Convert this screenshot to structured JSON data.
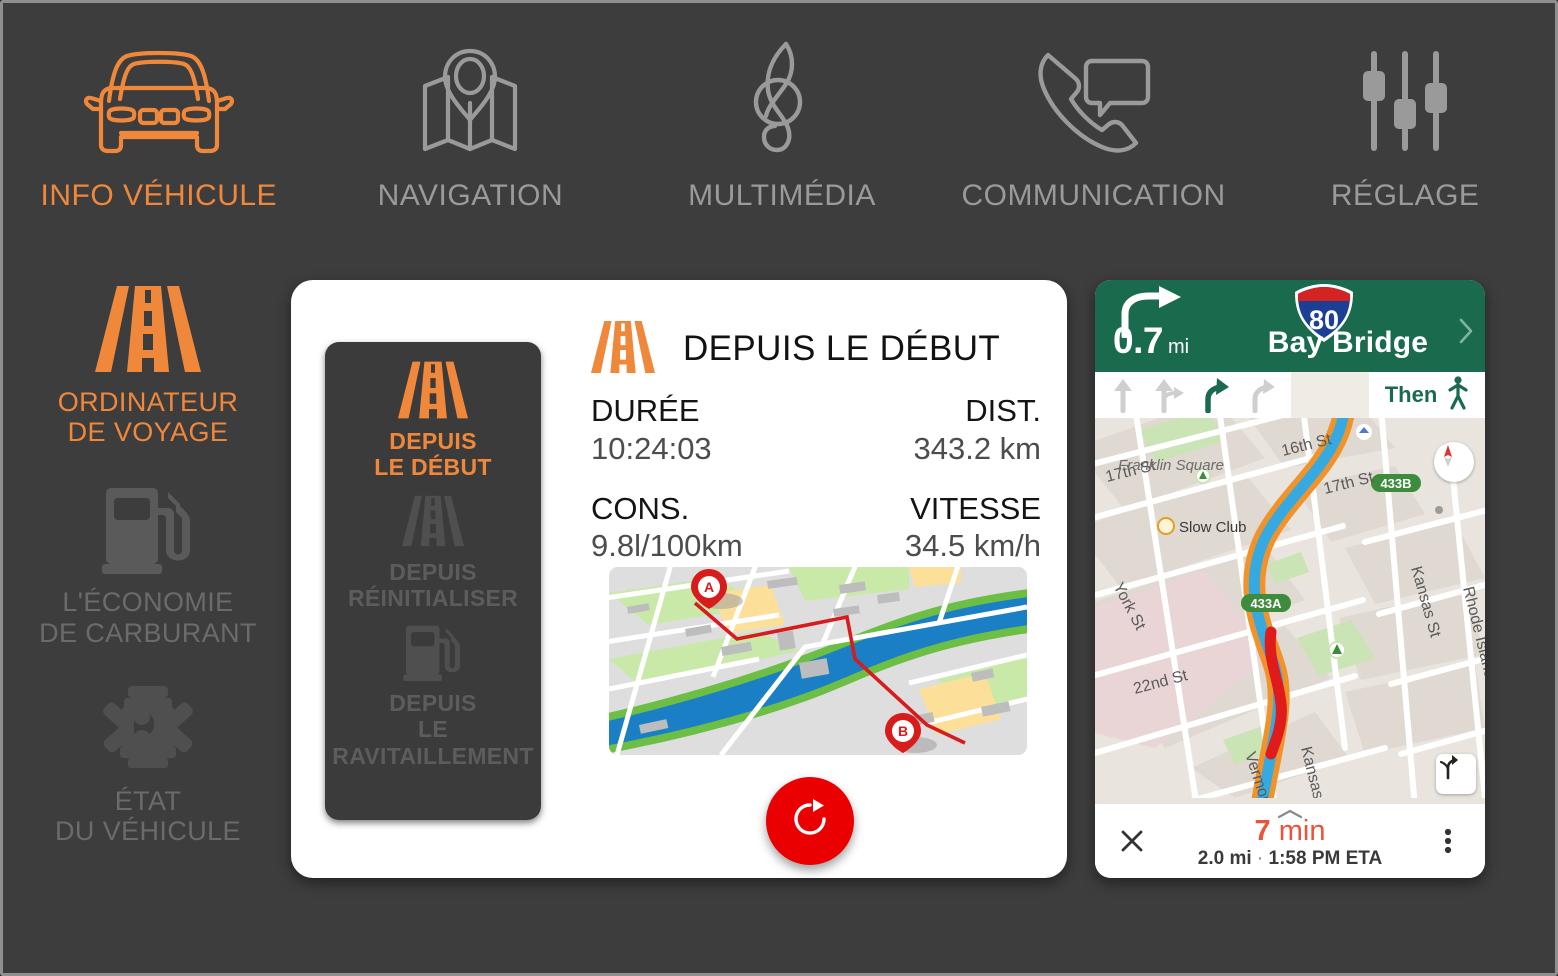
{
  "theme": {
    "background": "#3d3d3d",
    "accent_orange": "#f0883c",
    "inactive_gray": "#9a9a9a",
    "card_white": "#ffffff",
    "reset_red": "#ea0000",
    "nav_green": "#1a6b4e",
    "eta_red": "#e8553a"
  },
  "topnav": {
    "items": [
      {
        "label": "INFO VÉHICULE",
        "icon": "car-icon",
        "active": true
      },
      {
        "label": "NAVIGATION",
        "icon": "map-pin-icon",
        "active": false
      },
      {
        "label": "MULTIMÉDIA",
        "icon": "treble-clef-icon",
        "active": false
      },
      {
        "label": "COMMUNICATION",
        "icon": "phone-chat-icon",
        "active": false
      },
      {
        "label": "RÉGLAGE",
        "icon": "sliders-icon",
        "active": false
      }
    ]
  },
  "sidebar": {
    "items": [
      {
        "label_line1": "ORDINATEUR",
        "label_line2": "DE VOYAGE",
        "icon": "road-icon",
        "active": true
      },
      {
        "label_line1": "L'ÉCONOMIE",
        "label_line2": "DE CARBURANT",
        "icon": "fuel-pump-icon",
        "active": false
      },
      {
        "label_line1": "ÉTAT",
        "label_line2": "DU VÉHICULE",
        "icon": "engine-icon",
        "active": false
      }
    ]
  },
  "card": {
    "tabs": [
      {
        "line1": "DEPUIS",
        "line2": "LE DÉBUT",
        "line3": "",
        "icon": "road-icon",
        "active": true
      },
      {
        "line1": "DEPUIS",
        "line2": "RÉINITIALISER",
        "line3": "",
        "icon": "road-icon",
        "active": false
      },
      {
        "line1": "DEPUIS",
        "line2": "LE",
        "line3": "RAVITAILLEMENT",
        "icon": "fuel-pump-icon",
        "active": false
      }
    ],
    "panel": {
      "title": "DEPUIS LE DÉBUT",
      "icon": "road-icon",
      "stats": [
        {
          "label": "DURÉE",
          "value": "10:24:03",
          "align": "left"
        },
        {
          "label": "DIST.",
          "value": "343.2 km",
          "align": "right"
        },
        {
          "label": "CONS.",
          "value": "9.8l/100km",
          "align": "left"
        },
        {
          "label": "VITESSE",
          "value": "34.5 km/h",
          "align": "right"
        }
      ],
      "route_thumbnail": {
        "start_marker": "A",
        "end_marker": "B",
        "route_color": "#d61c1c"
      },
      "reset_button": {
        "icon": "refresh-icon",
        "color": "#ea0000"
      }
    }
  },
  "navigation": {
    "header": {
      "distance_value": "0.7",
      "distance_unit": "mi",
      "turn_icon": "turn-right-icon",
      "shield_label": "80",
      "shield_type": "interstate-shield-icon",
      "road_name": "Bay Bridge",
      "expand_icon": "chevron-right-icon"
    },
    "lanes": [
      {
        "icon": "lane-straight-icon",
        "active": false
      },
      {
        "icon": "lane-straight-right-icon",
        "active": false
      },
      {
        "icon": "lane-right-icon",
        "active": true
      },
      {
        "icon": "lane-right-icon",
        "active": false
      }
    ],
    "then": {
      "label": "Then",
      "icon": "pedestrian-icon"
    },
    "map": {
      "street_labels": [
        "17th St",
        "16th St",
        "17th St",
        "York St",
        "Kansas St",
        "Rhode Island St",
        "22nd St",
        "Franklin Square",
        "Slow Club"
      ],
      "exit_labels": [
        "433A",
        "433B"
      ],
      "position_marker": "blue-arrow-icon",
      "compass_icon": "compass-icon",
      "route_options_icon": "route-options-icon"
    },
    "footer": {
      "close_icon": "close-icon",
      "eta_minutes": "7",
      "eta_unit": "min",
      "remaining_distance": "2.0 mi",
      "separator": "·",
      "arrival_time": "1:58 PM ETA",
      "menu_icon": "more-vertical-icon",
      "handle_icon": "chevron-up-icon"
    }
  }
}
